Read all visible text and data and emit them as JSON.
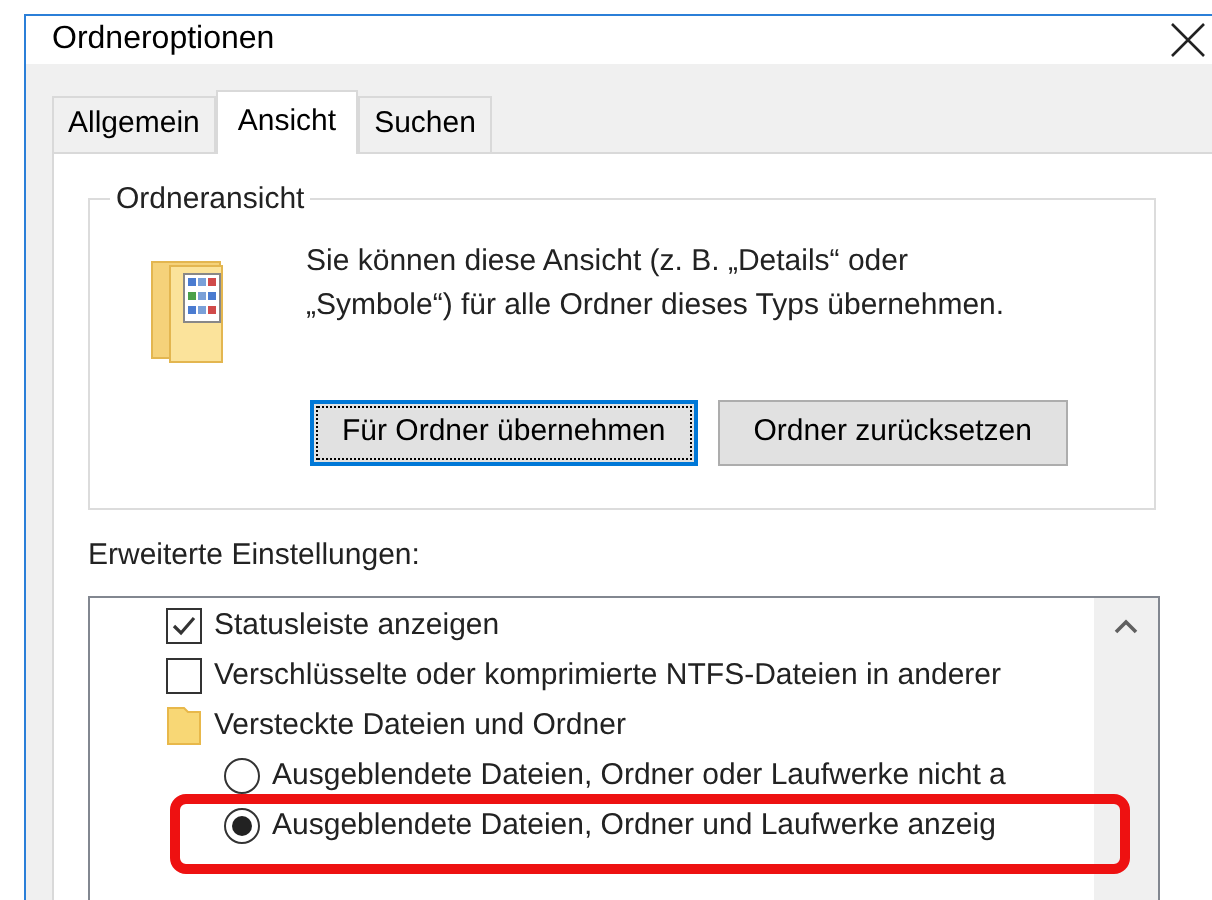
{
  "window": {
    "title": "Ordneroptionen"
  },
  "tabs": [
    {
      "label": "Allgemein",
      "selected": false
    },
    {
      "label": "Ansicht",
      "selected": true
    },
    {
      "label": "Suchen",
      "selected": false
    }
  ],
  "folder_view": {
    "title": "Ordneransicht",
    "description": "Sie können diese Ansicht (z. B. „Details“ oder „Symbole“) für alle Ordner dieses Typs übernehmen.",
    "buttons": [
      {
        "label": "Für Ordner übernehmen",
        "focused": true
      },
      {
        "label": "Ordner zurücksetzen",
        "focused": false
      }
    ]
  },
  "advanced": {
    "label": "Erweiterte Einstellungen:",
    "items": [
      {
        "kind": "checkbox",
        "label": "Statusleiste anzeigen",
        "checked": true,
        "highlighted": false
      },
      {
        "kind": "checkbox",
        "label": "Verschlüsselte oder komprimierte NTFS-Dateien in anderer",
        "checked": false,
        "highlighted": false
      },
      {
        "kind": "folder",
        "label": "Versteckte Dateien und Ordner",
        "highlighted": false
      },
      {
        "kind": "radio",
        "label": "Ausgeblendete Dateien, Ordner oder Laufwerke nicht a",
        "selected": false,
        "highlighted": false
      },
      {
        "kind": "radio",
        "label": "Ausgeblendete Dateien, Ordner und Laufwerke anzeig",
        "selected": true,
        "highlighted": true
      }
    ]
  }
}
